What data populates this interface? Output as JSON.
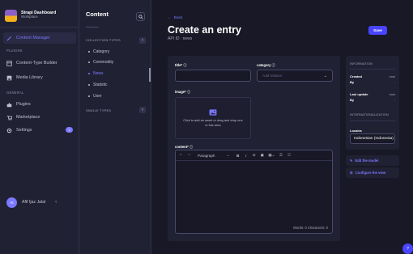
{
  "brand": {
    "title": "Strapi Dashboard",
    "subtitle": "Workplace"
  },
  "main_nav": {
    "content_manager": "Content Manager",
    "plugins_heading": "PLUGINS",
    "content_type_builder": "Content-Type Builder",
    "media_library": "Media Library",
    "general_heading": "GENERAL",
    "plugins": "Plugins",
    "marketplace": "Marketplace",
    "settings": "Settings",
    "settings_badge": "1"
  },
  "user": {
    "initials": "AI",
    "name": "Afif Ijaz Jalal"
  },
  "sub_nav": {
    "title": "Content",
    "collection_types_heading": "COLLECTION TYPES",
    "collection_types": [
      "Category",
      "Commodity",
      "News",
      "Statistic",
      "User"
    ],
    "single_types_heading": "SINGLE TYPES"
  },
  "header": {
    "back": "Back",
    "title": "Create an entry",
    "api_id": "API ID : news",
    "save": "Save"
  },
  "form": {
    "title_label": "title*",
    "category_label": "category",
    "category_placeholder": "Add relation",
    "image_label": "image*",
    "dropzone_text": "Click to add an asset or drag and drop one in this area",
    "content_label": "content*",
    "toolbar_style": "Paragraph",
    "word_count": "Words: 0  Characters: 0"
  },
  "info": {
    "heading": "INFORMATION",
    "created_label": "Created",
    "created_value": "now",
    "created_by_label": "By",
    "created_by_value": "-",
    "updated_label": "Last update",
    "updated_value": "now",
    "updated_by_label": "By",
    "updated_by_value": "-",
    "i18n_heading": "INTERNATIONALIZATION",
    "locales_label": "Locales",
    "locale_value": "Indonesian (Indonesia)"
  },
  "actions": {
    "edit_model": "Edit the model",
    "configure_view": "Configure the view"
  },
  "help": "?",
  "colors": {
    "accent": "#4945ff",
    "accent_text": "#7b79ff",
    "background": "#181826",
    "panel": "#212134"
  }
}
